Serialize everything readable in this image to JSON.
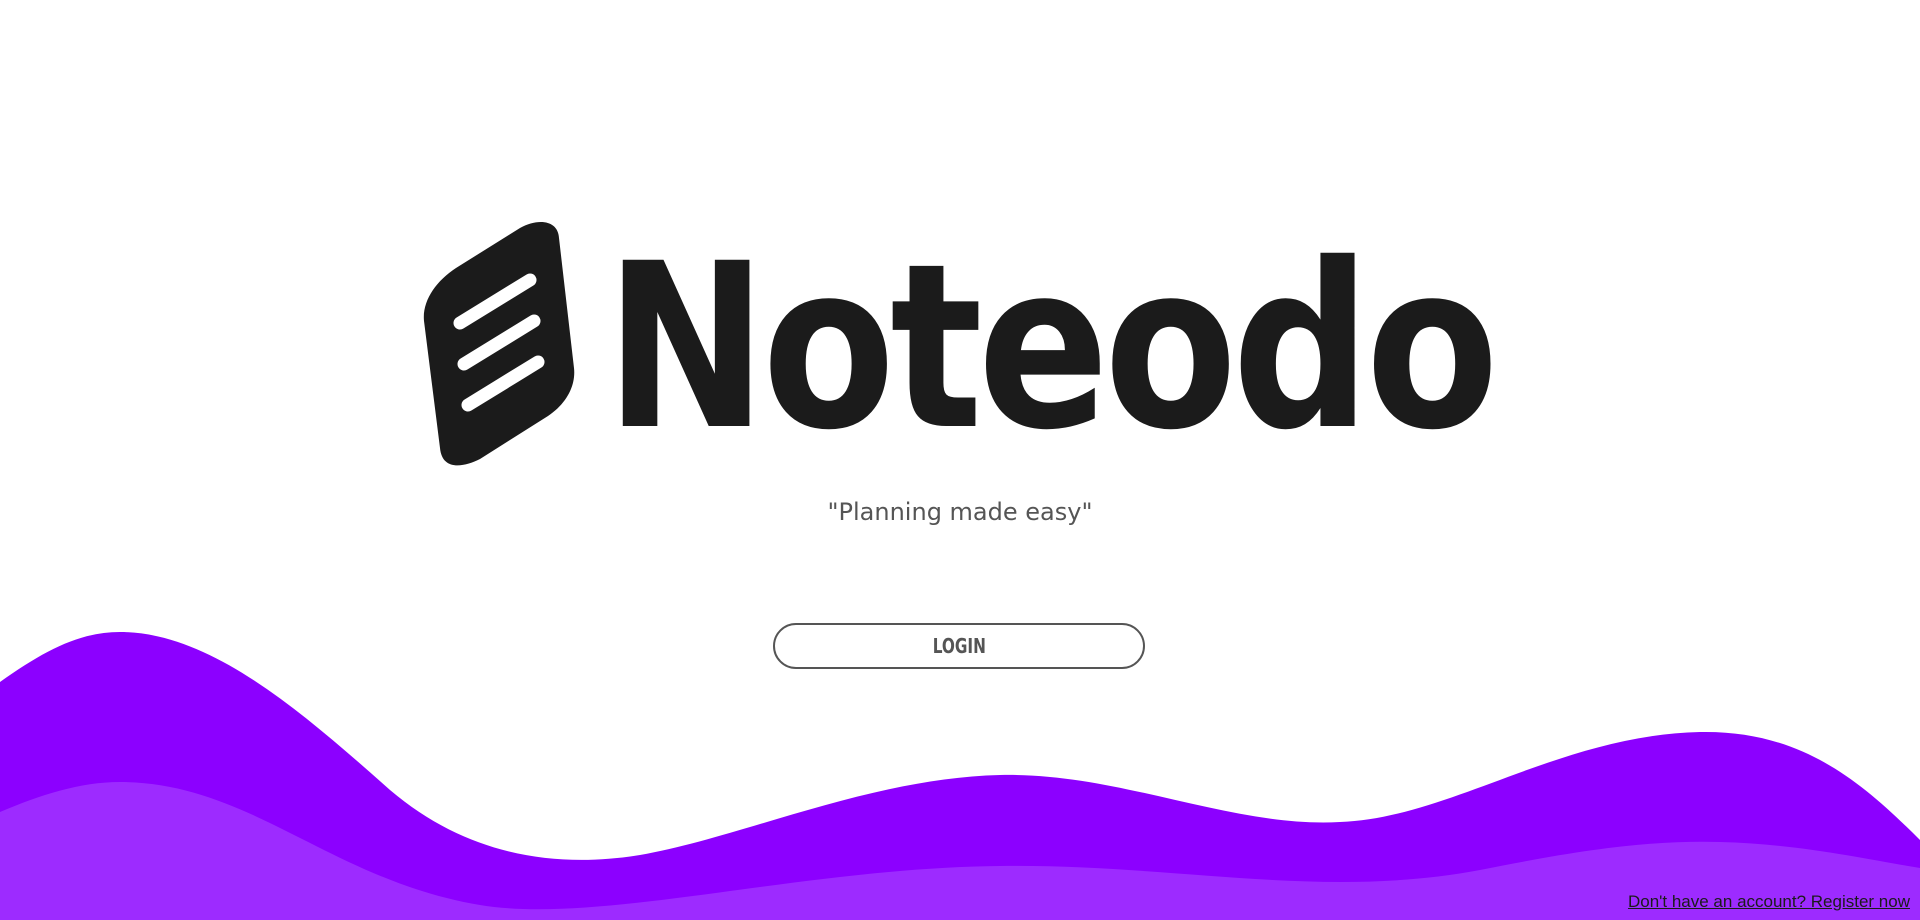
{
  "brand": {
    "name": "Noteodo",
    "logo_icon": "notepad-icon",
    "tagline": "\"Planning made easy\""
  },
  "actions": {
    "login_label": "LOGIN",
    "register_label": "Don't have an account? Register now"
  },
  "colors": {
    "wave_primary": "#8c00ff",
    "wave_secondary": "#9d2bff",
    "text_dark": "#1b1b1b",
    "text_muted": "#555555"
  }
}
